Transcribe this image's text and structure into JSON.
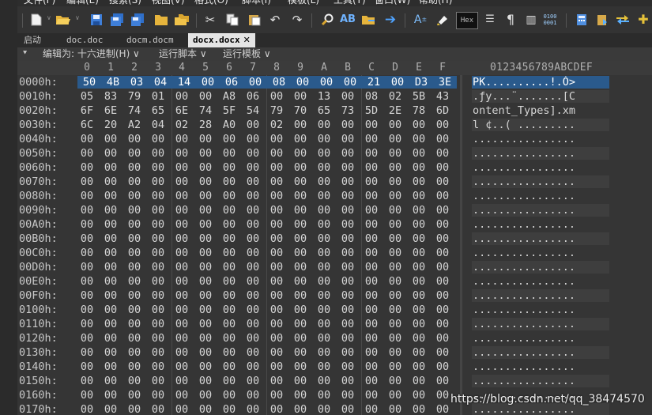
{
  "menu": [
    {
      "label": "文件(F)"
    },
    {
      "label": "编辑(E)"
    },
    {
      "label": "搜索(S)"
    },
    {
      "label": "视图(V)"
    },
    {
      "label": "格式(O)"
    },
    {
      "label": "脚本(I)"
    },
    {
      "label": "模板(L)"
    },
    {
      "label": "工具(T)"
    },
    {
      "label": "窗口(W)"
    },
    {
      "label": "帮助(H)"
    }
  ],
  "toolbar": {
    "hex_label": "Hex",
    "binary_label": "0100\n0001",
    "icons": [
      "new-file-icon",
      "open-folder-icon",
      "save-icon",
      "save-all-icon",
      "save-multiple-icon",
      "open-folder-2-icon",
      "folders-icon",
      "cut-icon",
      "copy-icon",
      "paste-icon",
      "undo-icon",
      "redo-icon",
      "find-icon",
      "replace-icon",
      "find-in-files-icon",
      "goto-icon",
      "font-size-icon",
      "highlight-icon",
      "hex-mode-icon",
      "text-mode-icon",
      "pilcrow-icon",
      "columns-icon",
      "binary-icon",
      "calculator-icon",
      "clipboard-icon",
      "compare-icon",
      "add-icon"
    ]
  },
  "tabs": [
    {
      "label": "启动",
      "active": false
    },
    {
      "label": "doc.doc",
      "active": false
    },
    {
      "label": "docm.docm",
      "active": false
    },
    {
      "label": "docx.docx",
      "active": true,
      "close": "✕"
    }
  ],
  "controls": {
    "editas": "编辑为: 十六进制(H) ∨",
    "script": "运行脚本 ∨",
    "template": "运行模板 ∨",
    "pin": "⯆"
  },
  "hex": {
    "column_headers": [
      "0",
      "1",
      "2",
      "3",
      "4",
      "5",
      "6",
      "7",
      "8",
      "9",
      "A",
      "B",
      "C",
      "D",
      "E",
      "F"
    ],
    "ascii_header": "0123456789ABCDEF",
    "rows": [
      {
        "offset": "0000h:",
        "bytes": [
          "50",
          "4B",
          "03",
          "04",
          "14",
          "00",
          "06",
          "00",
          "08",
          "00",
          "00",
          "00",
          "21",
          "00",
          "D3",
          "3E"
        ],
        "ascii": "PK..........!.Ó>"
      },
      {
        "offset": "0010h:",
        "bytes": [
          "05",
          "83",
          "79",
          "01",
          "00",
          "00",
          "A8",
          "06",
          "00",
          "00",
          "13",
          "00",
          "08",
          "02",
          "5B",
          "43"
        ],
        "ascii": ".ƒy...¨.......[C"
      },
      {
        "offset": "0020h:",
        "bytes": [
          "6F",
          "6E",
          "74",
          "65",
          "6E",
          "74",
          "5F",
          "54",
          "79",
          "70",
          "65",
          "73",
          "5D",
          "2E",
          "78",
          "6D"
        ],
        "ascii": "ontent_Types].xm"
      },
      {
        "offset": "0030h:",
        "bytes": [
          "6C",
          "20",
          "A2",
          "04",
          "02",
          "28",
          "A0",
          "00",
          "02",
          "00",
          "00",
          "00",
          "00",
          "00",
          "00",
          "00"
        ],
        "ascii": "l ¢..( ........."
      },
      {
        "offset": "0040h:",
        "bytes": [
          "00",
          "00",
          "00",
          "00",
          "00",
          "00",
          "00",
          "00",
          "00",
          "00",
          "00",
          "00",
          "00",
          "00",
          "00",
          "00"
        ],
        "ascii": "................"
      },
      {
        "offset": "0050h:",
        "bytes": [
          "00",
          "00",
          "00",
          "00",
          "00",
          "00",
          "00",
          "00",
          "00",
          "00",
          "00",
          "00",
          "00",
          "00",
          "00",
          "00"
        ],
        "ascii": "................"
      },
      {
        "offset": "0060h:",
        "bytes": [
          "00",
          "00",
          "00",
          "00",
          "00",
          "00",
          "00",
          "00",
          "00",
          "00",
          "00",
          "00",
          "00",
          "00",
          "00",
          "00"
        ],
        "ascii": "................"
      },
      {
        "offset": "0070h:",
        "bytes": [
          "00",
          "00",
          "00",
          "00",
          "00",
          "00",
          "00",
          "00",
          "00",
          "00",
          "00",
          "00",
          "00",
          "00",
          "00",
          "00"
        ],
        "ascii": "................"
      },
      {
        "offset": "0080h:",
        "bytes": [
          "00",
          "00",
          "00",
          "00",
          "00",
          "00",
          "00",
          "00",
          "00",
          "00",
          "00",
          "00",
          "00",
          "00",
          "00",
          "00"
        ],
        "ascii": "................"
      },
      {
        "offset": "0090h:",
        "bytes": [
          "00",
          "00",
          "00",
          "00",
          "00",
          "00",
          "00",
          "00",
          "00",
          "00",
          "00",
          "00",
          "00",
          "00",
          "00",
          "00"
        ],
        "ascii": "................"
      },
      {
        "offset": "00A0h:",
        "bytes": [
          "00",
          "00",
          "00",
          "00",
          "00",
          "00",
          "00",
          "00",
          "00",
          "00",
          "00",
          "00",
          "00",
          "00",
          "00",
          "00"
        ],
        "ascii": "................"
      },
      {
        "offset": "00B0h:",
        "bytes": [
          "00",
          "00",
          "00",
          "00",
          "00",
          "00",
          "00",
          "00",
          "00",
          "00",
          "00",
          "00",
          "00",
          "00",
          "00",
          "00"
        ],
        "ascii": "................"
      },
      {
        "offset": "00C0h:",
        "bytes": [
          "00",
          "00",
          "00",
          "00",
          "00",
          "00",
          "00",
          "00",
          "00",
          "00",
          "00",
          "00",
          "00",
          "00",
          "00",
          "00"
        ],
        "ascii": "................"
      },
      {
        "offset": "00D0h:",
        "bytes": [
          "00",
          "00",
          "00",
          "00",
          "00",
          "00",
          "00",
          "00",
          "00",
          "00",
          "00",
          "00",
          "00",
          "00",
          "00",
          "00"
        ],
        "ascii": "................"
      },
      {
        "offset": "00E0h:",
        "bytes": [
          "00",
          "00",
          "00",
          "00",
          "00",
          "00",
          "00",
          "00",
          "00",
          "00",
          "00",
          "00",
          "00",
          "00",
          "00",
          "00"
        ],
        "ascii": "................"
      },
      {
        "offset": "00F0h:",
        "bytes": [
          "00",
          "00",
          "00",
          "00",
          "00",
          "00",
          "00",
          "00",
          "00",
          "00",
          "00",
          "00",
          "00",
          "00",
          "00",
          "00"
        ],
        "ascii": "................"
      },
      {
        "offset": "0100h:",
        "bytes": [
          "00",
          "00",
          "00",
          "00",
          "00",
          "00",
          "00",
          "00",
          "00",
          "00",
          "00",
          "00",
          "00",
          "00",
          "00",
          "00"
        ],
        "ascii": "................"
      },
      {
        "offset": "0110h:",
        "bytes": [
          "00",
          "00",
          "00",
          "00",
          "00",
          "00",
          "00",
          "00",
          "00",
          "00",
          "00",
          "00",
          "00",
          "00",
          "00",
          "00"
        ],
        "ascii": "................"
      },
      {
        "offset": "0120h:",
        "bytes": [
          "00",
          "00",
          "00",
          "00",
          "00",
          "00",
          "00",
          "00",
          "00",
          "00",
          "00",
          "00",
          "00",
          "00",
          "00",
          "00"
        ],
        "ascii": "................"
      },
      {
        "offset": "0130h:",
        "bytes": [
          "00",
          "00",
          "00",
          "00",
          "00",
          "00",
          "00",
          "00",
          "00",
          "00",
          "00",
          "00",
          "00",
          "00",
          "00",
          "00"
        ],
        "ascii": "................"
      },
      {
        "offset": "0140h:",
        "bytes": [
          "00",
          "00",
          "00",
          "00",
          "00",
          "00",
          "00",
          "00",
          "00",
          "00",
          "00",
          "00",
          "00",
          "00",
          "00",
          "00"
        ],
        "ascii": "................"
      },
      {
        "offset": "0150h:",
        "bytes": [
          "00",
          "00",
          "00",
          "00",
          "00",
          "00",
          "00",
          "00",
          "00",
          "00",
          "00",
          "00",
          "00",
          "00",
          "00",
          "00"
        ],
        "ascii": "................"
      },
      {
        "offset": "0160h:",
        "bytes": [
          "00",
          "00",
          "00",
          "00",
          "00",
          "00",
          "00",
          "00",
          "00",
          "00",
          "00",
          "00",
          "00",
          "00",
          "00",
          "00"
        ],
        "ascii": "................"
      },
      {
        "offset": "0170h:",
        "bytes": [
          "00",
          "00",
          "00",
          "00",
          "00",
          "00",
          "00",
          "00",
          "00",
          "00",
          "00",
          "00",
          "00",
          "00",
          "00",
          "00"
        ],
        "ascii": "................"
      }
    ]
  },
  "selection": {
    "row": 0,
    "columns": "0-15"
  },
  "watermark": "https://blog.csdn.net/qq_38474570",
  "colors": {
    "selection": "#2a5a8c",
    "background": "#353535",
    "text": "#d6d6d6"
  }
}
